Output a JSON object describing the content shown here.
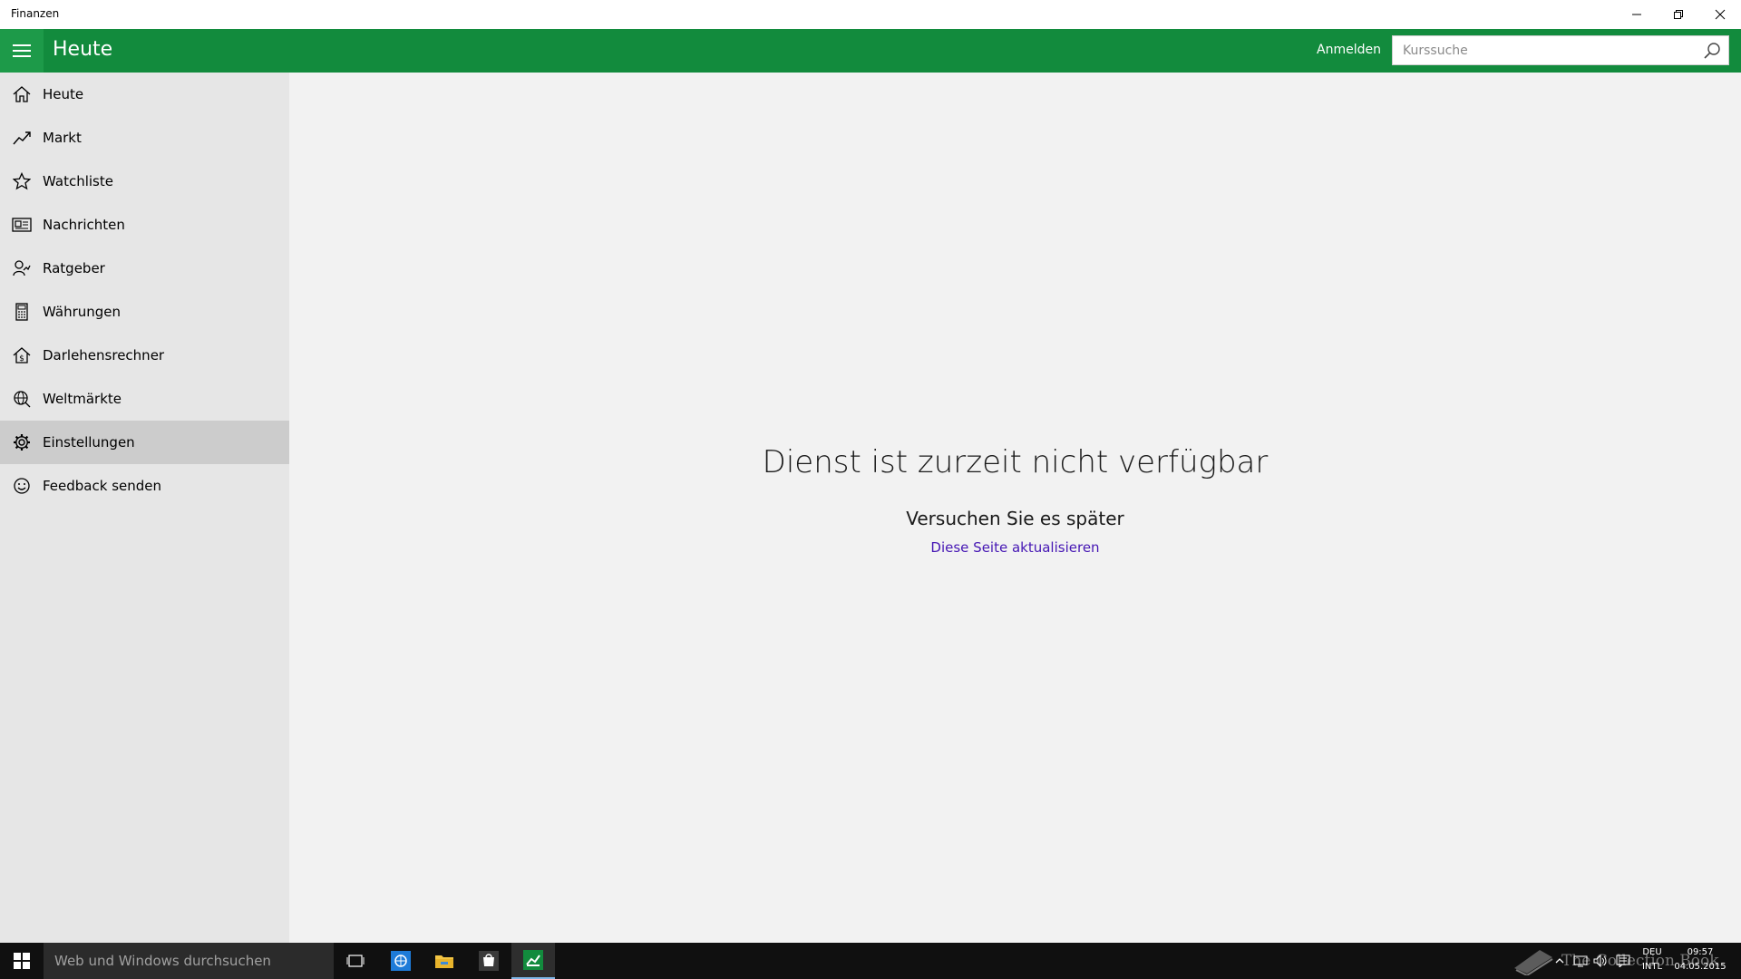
{
  "window": {
    "title": "Finanzen",
    "controls": [
      "minimize-icon",
      "restore-icon",
      "close-icon"
    ]
  },
  "header": {
    "title": "Heute",
    "signin_label": "Anmelden",
    "search_placeholder": "Kurssuche",
    "accent_color": "#128b3d"
  },
  "sidebar": {
    "items": [
      {
        "label": "Heute",
        "icon": "home-icon"
      },
      {
        "label": "Markt",
        "icon": "trend-line-icon"
      },
      {
        "label": "Watchliste",
        "icon": "star-icon"
      },
      {
        "label": "Nachrichten",
        "icon": "news-icon"
      },
      {
        "label": "Ratgeber",
        "icon": "advisor-icon"
      },
      {
        "label": "Währungen",
        "icon": "calculator-icon"
      },
      {
        "label": "Darlehensrechner",
        "icon": "house-dollar-icon"
      },
      {
        "label": "Weltmärkte",
        "icon": "globe-icon"
      },
      {
        "label": "Einstellungen",
        "icon": "gear-icon",
        "selected": true
      },
      {
        "label": "Feedback senden",
        "icon": "smiley-icon"
      }
    ]
  },
  "main": {
    "error_title": "Dienst ist zurzeit nicht verfügbar",
    "error_subtitle": "Versuchen Sie es später",
    "refresh_link": "Diese Seite aktualisieren",
    "link_color": "#4617b4"
  },
  "taskbar": {
    "search_placeholder": "Web und Windows durchsuchen",
    "apps": [
      "task-view-icon",
      "browser-icon",
      "file-explorer-icon",
      "store-icon",
      "finance-app-icon"
    ],
    "watermark": "The Collection Book",
    "language_line1": "DEU",
    "language_line2": "INTL",
    "time": "09:57",
    "date": "04.05.2015"
  }
}
